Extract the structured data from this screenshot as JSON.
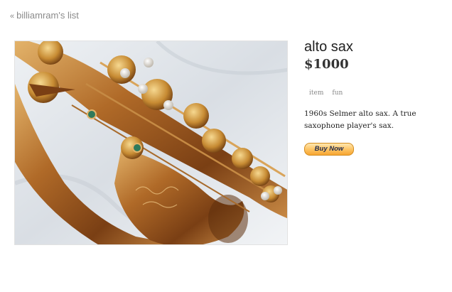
{
  "nav": {
    "back_chevron": "«",
    "back_label": "billiamram's list"
  },
  "listing": {
    "title": "alto sax",
    "price": "$1000",
    "tags": [
      "item",
      "fun"
    ],
    "description": "1960s Selmer alto sax. A true saxophone player's sax.",
    "buy_label": "Buy Now",
    "photo_alt": "saxophone-photo"
  },
  "colors": {
    "buy_button": "#fdc566",
    "brass": "#a9672a",
    "background_cloth": "#dfe3e8"
  }
}
